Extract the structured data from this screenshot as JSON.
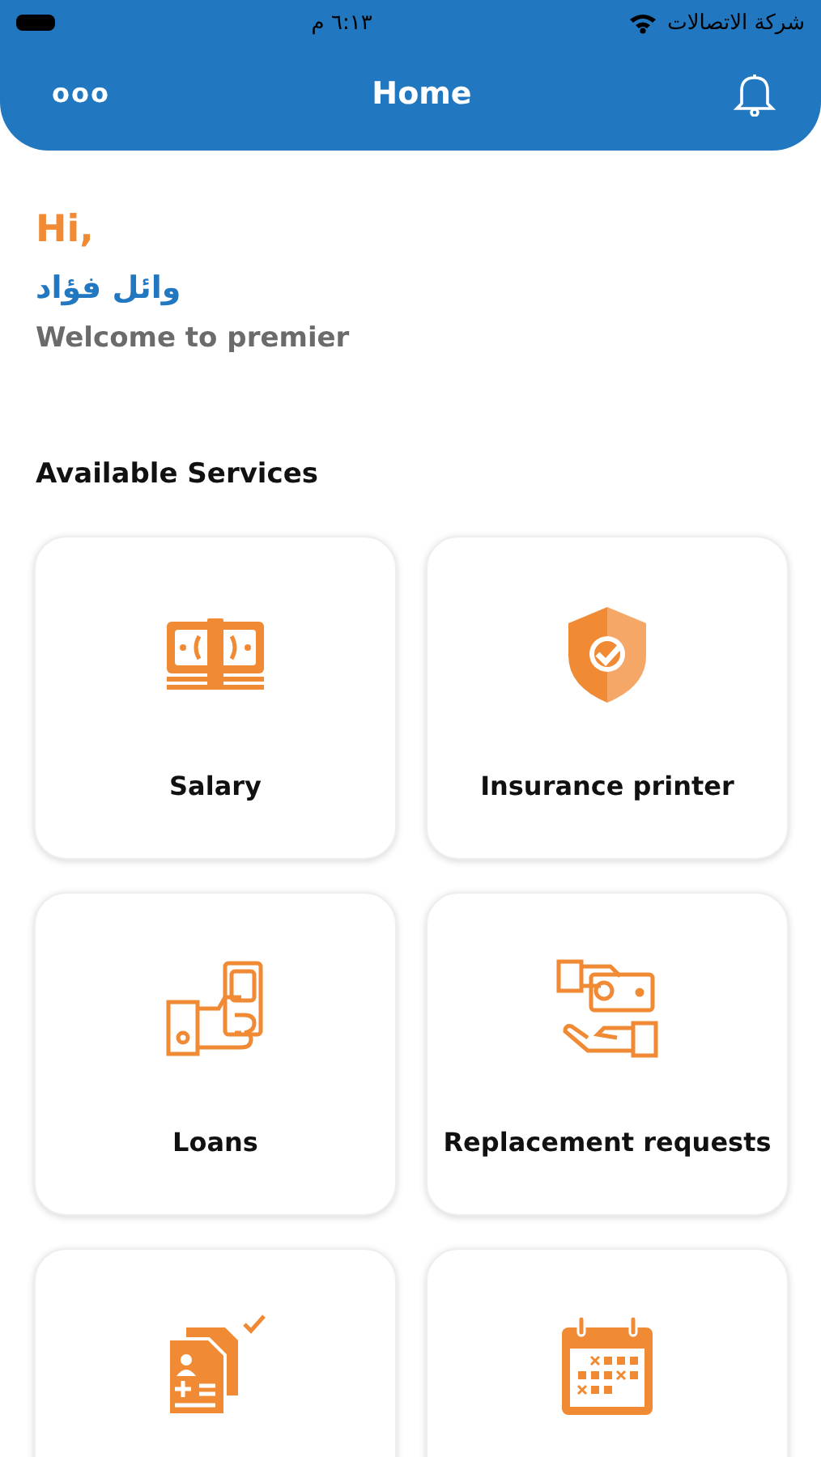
{
  "status_bar": {
    "time": "٦:١٣ م",
    "carrier": "شركة الاتصالات"
  },
  "nav": {
    "menu": "ooo",
    "title": "Home"
  },
  "greeting": {
    "hi": "Hi,",
    "name": "وائل فؤاد",
    "welcome": "Welcome to premier"
  },
  "section_title": "Available Services",
  "services": [
    {
      "kind": "money",
      "label": "Salary"
    },
    {
      "kind": "shield",
      "label": "Insurance printer"
    },
    {
      "kind": "loan",
      "label": "Loans"
    },
    {
      "kind": "exchange",
      "label": "Replacement requests"
    },
    {
      "kind": "documents"
    },
    {
      "kind": "calendar"
    }
  ]
}
